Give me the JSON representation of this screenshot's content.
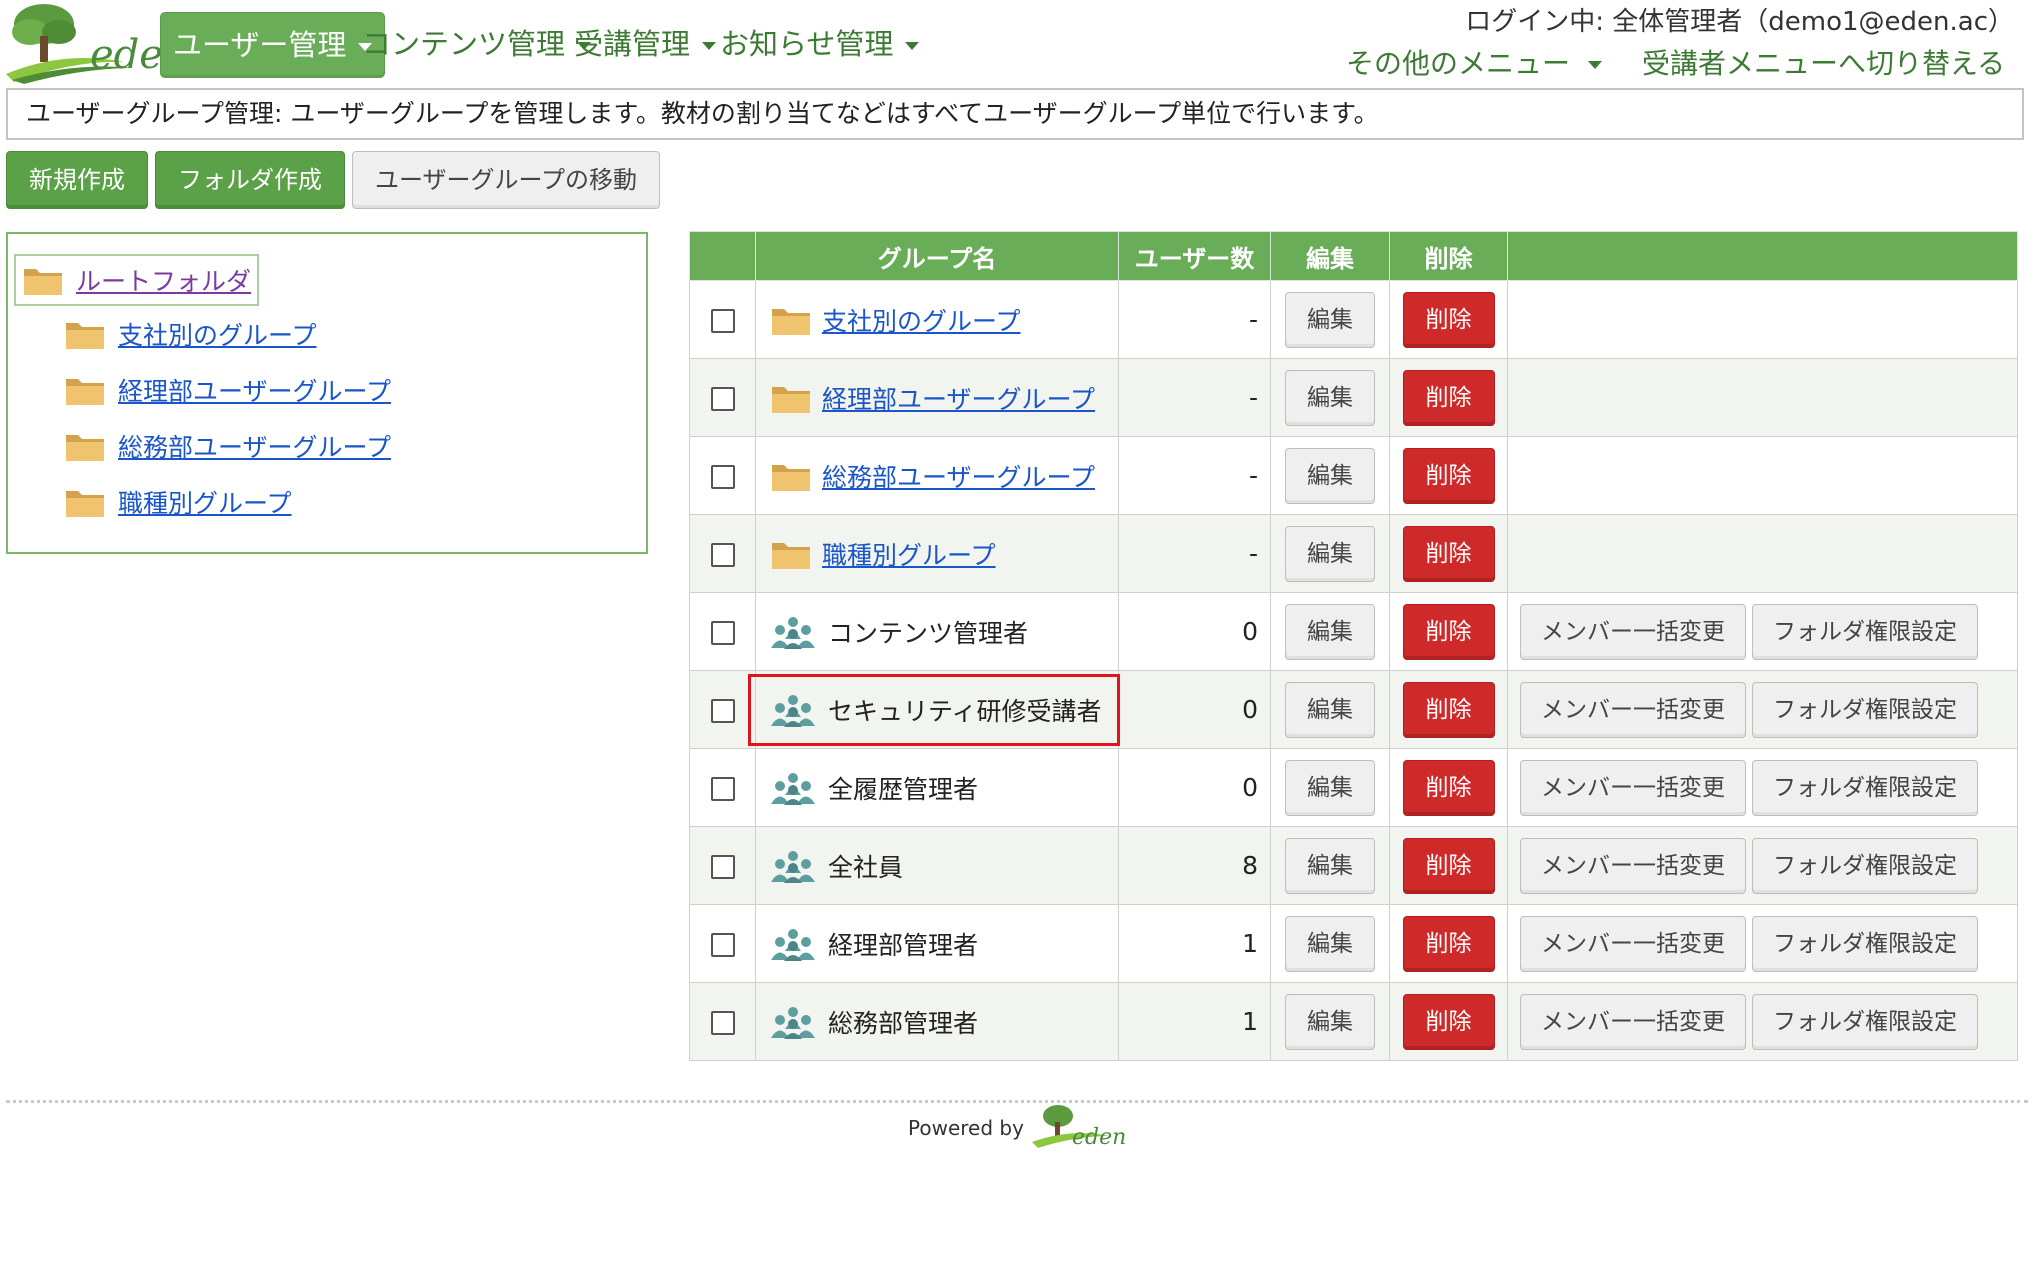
{
  "logo": {
    "text": "eden"
  },
  "nav": {
    "items": [
      {
        "label": "ユーザー管理",
        "active": true
      },
      {
        "label": "コンテンツ管理",
        "active": false
      },
      {
        "label": "受講管理",
        "active": false
      },
      {
        "label": "お知らせ管理",
        "active": false
      }
    ],
    "login_info": "ログイン中: 全体管理者（demo1@eden.ac）",
    "other_menu": "その他のメニュー",
    "switch_menu": "受講者メニューへ切り替える"
  },
  "description": "ユーザーグループ管理: ユーザーグループを管理します。教材の割り当てなどはすべてユーザーグループ単位で行います。",
  "actions": {
    "new_label": "新規作成",
    "folder_label": "フォルダ作成",
    "move_label": "ユーザーグループの移動"
  },
  "tree": {
    "root": "ルートフォルダ",
    "items": [
      "支社別のグループ",
      "経理部ユーザーグループ",
      "総務部ユーザーグループ",
      "職種別グループ"
    ]
  },
  "table": {
    "headers": {
      "name": "グループ名",
      "users": "ユーザー数",
      "edit": "編集",
      "delete": "削除"
    },
    "edit_label": "編集",
    "delete_label": "削除",
    "bulk_label": "メンバー一括変更",
    "perm_label": "フォルダ権限設定",
    "rows": [
      {
        "type": "folder",
        "name": "支社別のグループ",
        "count": "-"
      },
      {
        "type": "folder",
        "name": "経理部ユーザーグループ",
        "count": "-"
      },
      {
        "type": "folder",
        "name": "総務部ユーザーグループ",
        "count": "-"
      },
      {
        "type": "folder",
        "name": "職種別グループ",
        "count": "-"
      },
      {
        "type": "group",
        "name": "コンテンツ管理者",
        "count": "0"
      },
      {
        "type": "group",
        "name": "セキュリティ研修受講者",
        "count": "0",
        "highlighted": true
      },
      {
        "type": "group",
        "name": "全履歴管理者",
        "count": "0"
      },
      {
        "type": "group",
        "name": "全社員",
        "count": "8"
      },
      {
        "type": "group",
        "name": "経理部管理者",
        "count": "1"
      },
      {
        "type": "group",
        "name": "総務部管理者",
        "count": "1"
      }
    ]
  },
  "footer": {
    "powered_by": "Powered by",
    "logo_text": "eden"
  },
  "colors": {
    "brand_green": "#6aad58",
    "link_blue": "#1a55c9",
    "delete_red": "#cf2a2a",
    "highlight_red": "#e0141e"
  }
}
